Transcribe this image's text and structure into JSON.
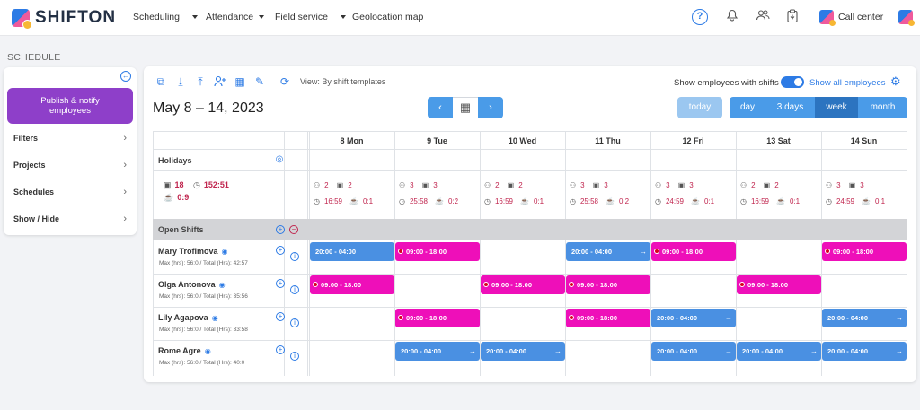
{
  "app": {
    "logo": "SHIFTON"
  },
  "nav": {
    "scheduling": "Scheduling",
    "attendance": "Attendance",
    "field_service": "Field service",
    "geolocation": "Geolocation map",
    "call_center": "Call center",
    "help": "?"
  },
  "page": {
    "section": "SCHEDULE"
  },
  "sidebar": {
    "publish": "Publish & notify employees",
    "items": [
      {
        "label": "Filters"
      },
      {
        "label": "Projects"
      },
      {
        "label": "Schedules"
      },
      {
        "label": "Show / Hide"
      }
    ]
  },
  "toolbar": {
    "view_label": "View: By shift templates",
    "show_with_shifts": "Show employees with shifts",
    "show_all": "Show all employees",
    "date_range": "May 8 – 14, 2023",
    "today": "today",
    "ranges": [
      "day",
      "3 days",
      "week",
      "month"
    ],
    "active_range": "week"
  },
  "days": [
    "8 Mon",
    "9 Tue",
    "10 Wed",
    "11 Thu",
    "12 Fri",
    "13 Sat",
    "14 Sun"
  ],
  "rows": {
    "holidays": "Holidays",
    "open_shifts": "Open Shifts",
    "totals": {
      "people": "18",
      "hours": "152:51",
      "breaks": "0:9"
    }
  },
  "day_stats": [
    {
      "people": "2",
      "shifts": "2",
      "hours": "16:59",
      "breaks": "0:1"
    },
    {
      "people": "3",
      "shifts": "3",
      "hours": "25:58",
      "breaks": "0:2"
    },
    {
      "people": "2",
      "shifts": "2",
      "hours": "16:59",
      "breaks": "0:1"
    },
    {
      "people": "3",
      "shifts": "3",
      "hours": "25:58",
      "breaks": "0:2"
    },
    {
      "people": "3",
      "shifts": "3",
      "hours": "24:59",
      "breaks": "0:1"
    },
    {
      "people": "2",
      "shifts": "2",
      "hours": "16:59",
      "breaks": "0:1"
    },
    {
      "people": "3",
      "shifts": "3",
      "hours": "24:59",
      "breaks": "0:1"
    }
  ],
  "employees": [
    {
      "name": "Mary Trofimova",
      "sub": "Max (hrs): 56:0 / Total (Hrs): 42:57",
      "shifts": [
        {
          "day": 0,
          "time": "20:00 - 04:00",
          "color": "blue"
        },
        {
          "day": 1,
          "time": "09:00 - 18:00",
          "color": "pink"
        },
        {
          "day": 3,
          "time": "20:00 - 04:00",
          "color": "blue"
        },
        {
          "day": 4,
          "time": "09:00 - 18:00",
          "color": "pink"
        },
        {
          "day": 6,
          "time": "09:00 - 18:00",
          "color": "pink"
        }
      ]
    },
    {
      "name": "Olga Antonova",
      "sub": "Max (hrs): 56:0 / Total (Hrs): 35:56",
      "shifts": [
        {
          "day": 0,
          "time": "09:00 - 18:00",
          "color": "pink"
        },
        {
          "day": 2,
          "time": "09:00 - 18:00",
          "color": "pink"
        },
        {
          "day": 3,
          "time": "09:00 - 18:00",
          "color": "pink"
        },
        {
          "day": 5,
          "time": "09:00 - 18:00",
          "color": "pink"
        }
      ]
    },
    {
      "name": "Lily Agapova",
      "sub": "Max (hrs): 56:0 / Total (Hrs): 33:58",
      "shifts": [
        {
          "day": 1,
          "time": "09:00 - 18:00",
          "color": "pink"
        },
        {
          "day": 3,
          "time": "09:00 - 18:00",
          "color": "pink"
        },
        {
          "day": 4,
          "time": "20:00 - 04:00",
          "color": "blue"
        },
        {
          "day": 6,
          "time": "20:00 - 04:00",
          "color": "blue"
        }
      ]
    },
    {
      "name": "Rome Agre",
      "sub": "Max (hrs): 56:0 / Total (Hrs): 40:0",
      "shifts": [
        {
          "day": 1,
          "time": "20:00 - 04:00",
          "color": "blue"
        },
        {
          "day": 2,
          "time": "20:00 - 04:00",
          "color": "blue"
        },
        {
          "day": 4,
          "time": "20:00 - 04:00",
          "color": "blue"
        },
        {
          "day": 5,
          "time": "20:00 - 04:00",
          "color": "blue"
        },
        {
          "day": 6,
          "time": "20:00 - 04:00",
          "color": "blue"
        }
      ]
    }
  ],
  "colors": {
    "pink": "#ee0fb9",
    "blue": "#4a90e2",
    "accent": "#2d7be5",
    "publish": "#8e3fc9"
  }
}
